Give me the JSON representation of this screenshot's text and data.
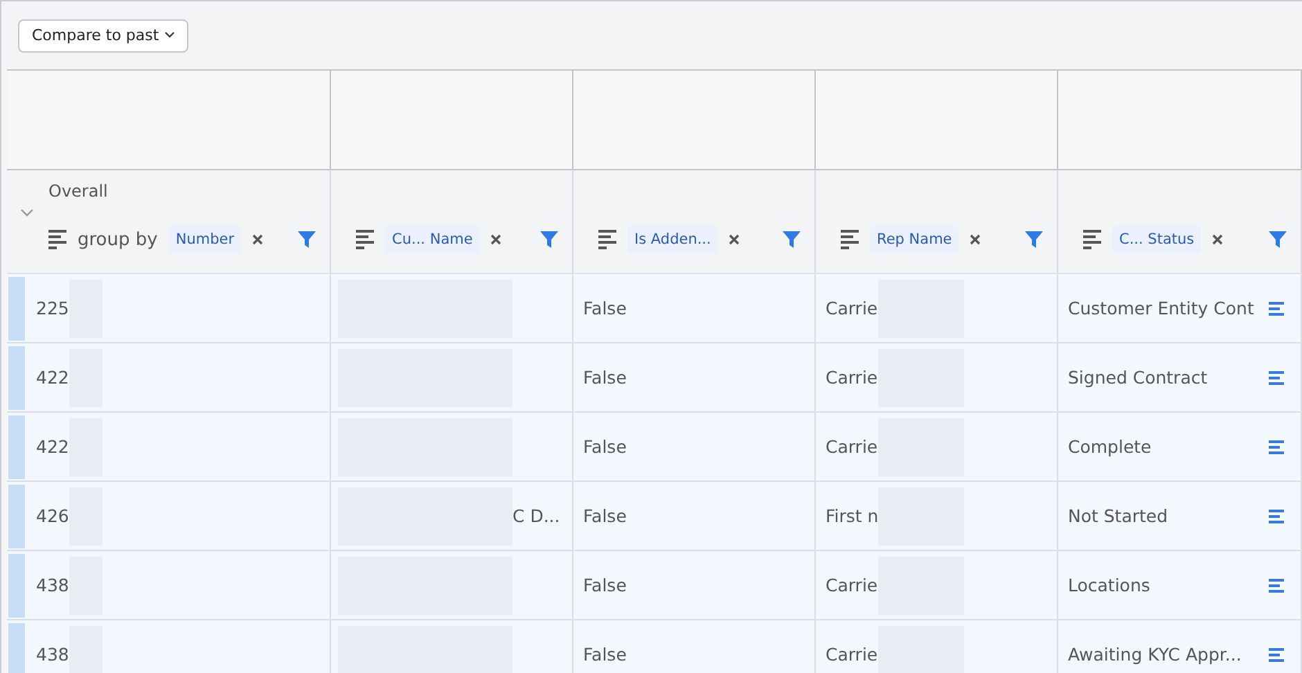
{
  "toolbar": {
    "compare_button": "Compare to past"
  },
  "group_header": {
    "title": "Overall",
    "group_by_label": "group by"
  },
  "columns": [
    {
      "chip": "Number"
    },
    {
      "chip": "Cu...  Name"
    },
    {
      "chip": "Is Adden..."
    },
    {
      "chip": "Rep Name"
    },
    {
      "chip": "C...  Status"
    }
  ],
  "rows": [
    {
      "number": "225",
      "name": "",
      "addendum": "False",
      "rep": "Carrie",
      "status": "Customer Entity Cont"
    },
    {
      "number": "422",
      "name": "",
      "addendum": "False",
      "rep": "Carrie",
      "status": "Signed Contract"
    },
    {
      "number": "422",
      "name": "",
      "addendum": "False",
      "rep": "Carrie",
      "status": "Complete"
    },
    {
      "number": "426",
      "name": "C D...",
      "addendum": "False",
      "rep": "First n",
      "status": "Not Started"
    },
    {
      "number": "438",
      "name": "",
      "addendum": "False",
      "rep": "Carrie",
      "status": "Locations"
    },
    {
      "number": "438",
      "name": "",
      "addendum": "False",
      "rep": "Carrie",
      "status": "Awaiting KYC Appr..."
    }
  ]
}
